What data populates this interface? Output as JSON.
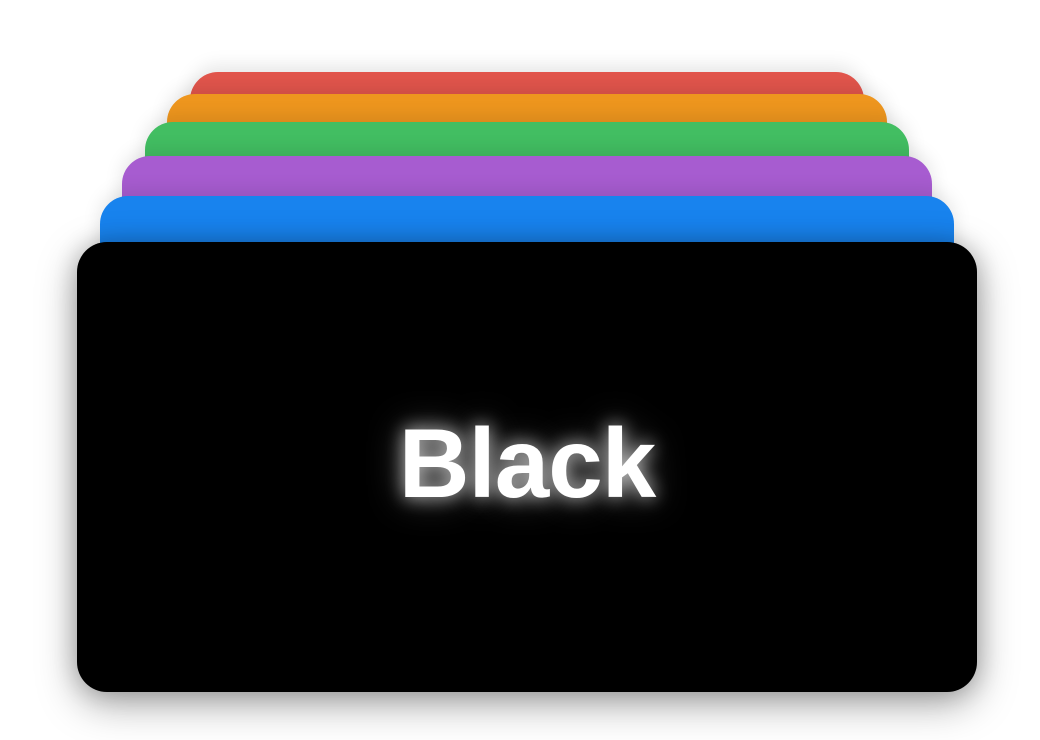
{
  "cards": [
    {
      "id": "red",
      "color": "#E2554C"
    },
    {
      "id": "orange",
      "color": "#EE961E"
    },
    {
      "id": "green",
      "color": "#42BE62"
    },
    {
      "id": "purple",
      "color": "#A75CD0"
    },
    {
      "id": "blue",
      "color": "#1883EE"
    }
  ],
  "front_card": {
    "title": "Black",
    "color": "#000000",
    "text_color": "#FFFFFF"
  }
}
